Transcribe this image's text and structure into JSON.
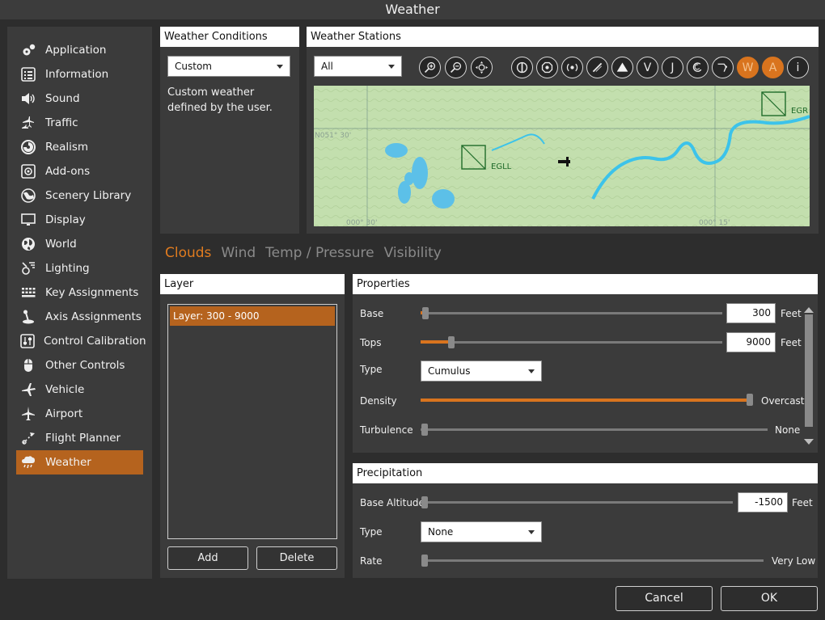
{
  "window": {
    "title": "Weather"
  },
  "sidebar": {
    "items": [
      {
        "label": "Application",
        "icon": "gears-icon"
      },
      {
        "label": "Information",
        "icon": "list-icon"
      },
      {
        "label": "Sound",
        "icon": "speaker-icon"
      },
      {
        "label": "Traffic",
        "icon": "traffic-planes-icon"
      },
      {
        "label": "Realism",
        "icon": "realism-icon"
      },
      {
        "label": "Add-ons",
        "icon": "addons-icon"
      },
      {
        "label": "Scenery Library",
        "icon": "scenery-icon"
      },
      {
        "label": "Display",
        "icon": "monitor-icon"
      },
      {
        "label": "World",
        "icon": "globe-icon"
      },
      {
        "label": "Lighting",
        "icon": "lighting-icon"
      },
      {
        "label": "Key Assignments",
        "icon": "keyboard-icon"
      },
      {
        "label": "Axis Assignments",
        "icon": "joystick-icon"
      },
      {
        "label": "Control Calibration",
        "icon": "calibration-icon"
      },
      {
        "label": "Other Controls",
        "icon": "controller-icon"
      },
      {
        "label": "Vehicle",
        "icon": "plane-icon"
      },
      {
        "label": "Airport",
        "icon": "airport-icon"
      },
      {
        "label": "Flight Planner",
        "icon": "flight-planner-icon"
      },
      {
        "label": "Weather",
        "icon": "weather-icon"
      }
    ],
    "active": "Weather",
    "accent": "#b5631e"
  },
  "conditions": {
    "title": "Weather Conditions",
    "selected": "Custom",
    "description": "Custom weather defined by the user."
  },
  "stations": {
    "title": "Weather Stations",
    "filter": "All",
    "tools": [
      "zoom-in-icon",
      "zoom-out-icon",
      "recenter-icon",
      "vor-icon",
      "ndb-icon",
      "fix-icon",
      "runway-icon",
      "triangle-icon",
      "v-icon",
      "j-icon",
      "traffic-pattern-icon",
      "route-icon",
      "w-icon",
      "a-icon",
      "info-icon"
    ],
    "tool_letters": {
      "v": "V",
      "j": "J",
      "w": "W",
      "a": "A",
      "i": "i"
    },
    "map": {
      "stations": [
        {
          "id": "EGLL"
        },
        {
          "id": "EGR"
        }
      ],
      "lat_label": "N051° 30'",
      "lon_labels": [
        "000° 30'",
        "000° 15'"
      ]
    }
  },
  "tabs": [
    {
      "label": "Clouds",
      "active": true
    },
    {
      "label": "Wind",
      "active": false
    },
    {
      "label": "Temp / Pressure",
      "active": false
    },
    {
      "label": "Visibility",
      "active": false
    }
  ],
  "layer": {
    "title": "Layer",
    "items": [
      "Layer: 300 - 9000"
    ],
    "add_label": "Add",
    "delete_label": "Delete"
  },
  "properties": {
    "title": "Properties",
    "base_label": "Base",
    "base_value": "300",
    "base_unit": "Feet",
    "tops_label": "Tops",
    "tops_value": "9000",
    "tops_unit": "Feet",
    "type_label": "Type",
    "type_value": "Cumulus",
    "density_label": "Density",
    "density_value": "Overcast",
    "turbulence_label": "Turbulence",
    "turbulence_value": "None"
  },
  "precipitation": {
    "title": "Precipitation",
    "base_label": "Base Altitude",
    "base_value": "-1500",
    "base_unit": "Feet",
    "type_label": "Type",
    "type_value": "None",
    "rate_label": "Rate",
    "rate_value": "Very Low"
  },
  "footer": {
    "cancel_label": "Cancel",
    "ok_label": "OK"
  }
}
